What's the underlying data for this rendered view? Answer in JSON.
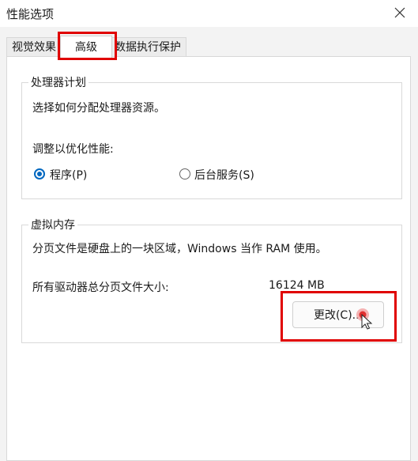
{
  "window": {
    "title": "性能选项"
  },
  "tabs": [
    {
      "label": "视觉效果"
    },
    {
      "label": "高级"
    },
    {
      "label": "数据执行保护"
    }
  ],
  "processor": {
    "title": "处理器计划",
    "description": "选择如何分配处理器资源。",
    "optimize_label": "调整以优化性能:",
    "options": [
      {
        "label": "程序(P)",
        "checked": true
      },
      {
        "label": "后台服务(S)",
        "checked": false
      }
    ]
  },
  "virtual_memory": {
    "title": "虚拟内存",
    "description": "分页文件是硬盘上的一块区域，Windows 当作 RAM 使用。",
    "total_label": "所有驱动器总分页文件大小:",
    "total_value": "16124 MB",
    "change_button": "更改(C)..."
  },
  "colors": {
    "accent": "#0067c0",
    "highlight": "#e00000"
  }
}
